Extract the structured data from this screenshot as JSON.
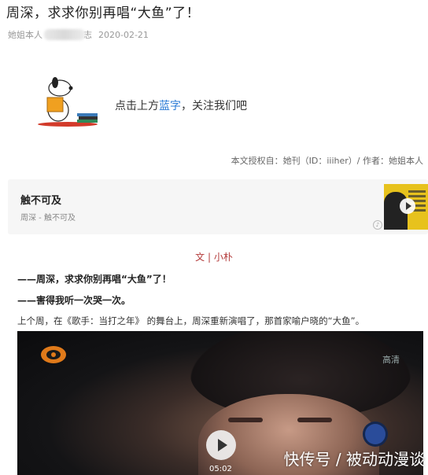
{
  "article": {
    "title": "周深，求求你别再唱“大鱼”了！",
    "author_prefix": "她姐本人",
    "author_suffix": "志",
    "date": "2020-02-21"
  },
  "follow": {
    "text_before": "点击上方",
    "highlight": "蓝字",
    "text_after": "，关注我们吧",
    "highlight_color": "#2b7bd6"
  },
  "copyright": "本文授权自：她刊（ID：iiiher）/ 作者：她姐本人",
  "music_card": {
    "song": "触不可及",
    "artist": "周深 - 触不可及"
  },
  "body": {
    "byline": "文 | 小朴",
    "bold_line_1": "——周深，求求你别再唱“大鱼”了！",
    "bold_line_2": "——害得我听一次哭一次。",
    "paragraph": "上个周，在《歌手：当打之年》 的舞台上，周深重新演唱了，那首家喻户晓的“大鱼”。"
  },
  "video": {
    "channel_badge": "高清",
    "duration": "05:02"
  },
  "watermark": "快传号 / 被动动漫谈"
}
